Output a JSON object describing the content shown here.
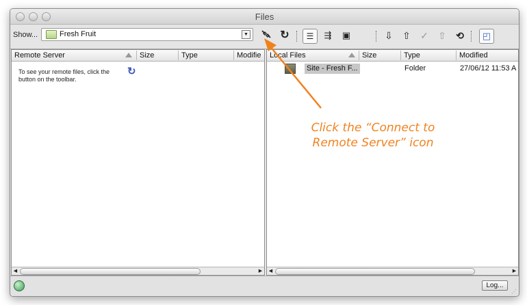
{
  "window": {
    "title": "Files"
  },
  "toolbar": {
    "show_label": "Show...",
    "site_select": {
      "value": "Fresh Fruit"
    },
    "icons": [
      "connect-icon",
      "refresh-icon",
      "list-view-icon",
      "synchronize-icon",
      "cloaking-icon",
      "get-icon",
      "put-icon",
      "check-out-icon",
      "check-in-icon",
      "sync-icon",
      "expand-icon"
    ]
  },
  "remote_pane": {
    "columns": {
      "name": "Remote Server",
      "size": "Size",
      "type": "Type",
      "modified": "Modifie"
    },
    "message": "To see your remote files, click the button on the toolbar."
  },
  "local_pane": {
    "columns": {
      "name": "Local Files",
      "size": "Size",
      "type": "Type",
      "modified": "Modified"
    },
    "rows": [
      {
        "name": "Site - Fresh F...",
        "type": "Folder",
        "modified": "27/06/12 11:53 A"
      }
    ]
  },
  "statusbar": {
    "log_label": "Log..."
  },
  "annotation": {
    "line1": "Click the “Connect to",
    "line2": "Remote Server” icon",
    "color": "#f0821e"
  }
}
